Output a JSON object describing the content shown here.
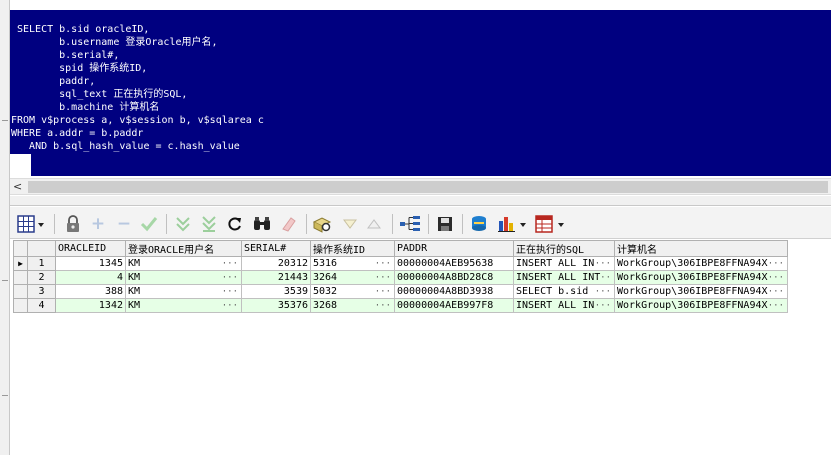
{
  "sql_lines": [
    "SELECT b.sid oracleID,",
    "       b.username 登录Oracle用户名,",
    "       b.serial#,",
    "       spid 操作系统ID,",
    "       paddr,",
    "       sql_text 正在执行的SQL,",
    "       b.machine 计算机名",
    "FROM v$process a, v$session b, v$sqlarea c",
    "WHERE a.addr = b.paddr",
    "   AND b.sql_hash_value = c.hash_value"
  ],
  "scroll_left_glyph": "<",
  "toolbar": {
    "icons": [
      "grid-icon",
      "lock-icon",
      "add-icon",
      "remove-icon",
      "check-icon",
      "fetch-next-icon",
      "fetch-all-icon",
      "refresh-icon",
      "find-icon",
      "clear-icon",
      "query-by-example-icon",
      "sort-desc-icon",
      "sort-asc-icon",
      "tree-icon",
      "save-icon",
      "export-icon",
      "chart-icon",
      "table-icon"
    ]
  },
  "grid": {
    "columns": [
      "ORACLEID",
      "登录ORACLE用户名",
      "SERIAL#",
      "操作系统ID",
      "PADDR",
      "正在执行的SQL",
      "计算机名"
    ],
    "rows": [
      {
        "num": "1",
        "current": true,
        "oracleid": "1345",
        "username": "KM",
        "serial": "20312",
        "spid": "5316",
        "paddr": "00000004AEB95638",
        "sql": "INSERT ALL  IN",
        "machine": "WorkGroup\\306IBPE8FFNA94X"
      },
      {
        "num": "2",
        "current": false,
        "oracleid": "4",
        "username": "KM",
        "serial": "21443",
        "spid": "3264",
        "paddr": "00000004A8BD28C8",
        "sql": "INSERT ALL INT",
        "machine": "WorkGroup\\306IBPE8FFNA94X"
      },
      {
        "num": "3",
        "current": false,
        "oracleid": "388",
        "username": "KM",
        "serial": "3539",
        "spid": "5032",
        "paddr": "00000004A8BD3938",
        "sql": " SELECT b.sid",
        "machine": "WorkGroup\\306IBPE8FFNA94X"
      },
      {
        "num": "4",
        "current": false,
        "oracleid": "1342",
        "username": "KM",
        "serial": "35376",
        "spid": "3268",
        "paddr": "00000004AEB997F8",
        "sql": "INSERT ALL  IN",
        "machine": "WorkGroup\\306IBPE8FFNA94X"
      }
    ],
    "current_indicator": "▶",
    "ellipsis": "···"
  },
  "colors": {
    "selection": "#000080",
    "row_even": "#e6ffe6"
  }
}
